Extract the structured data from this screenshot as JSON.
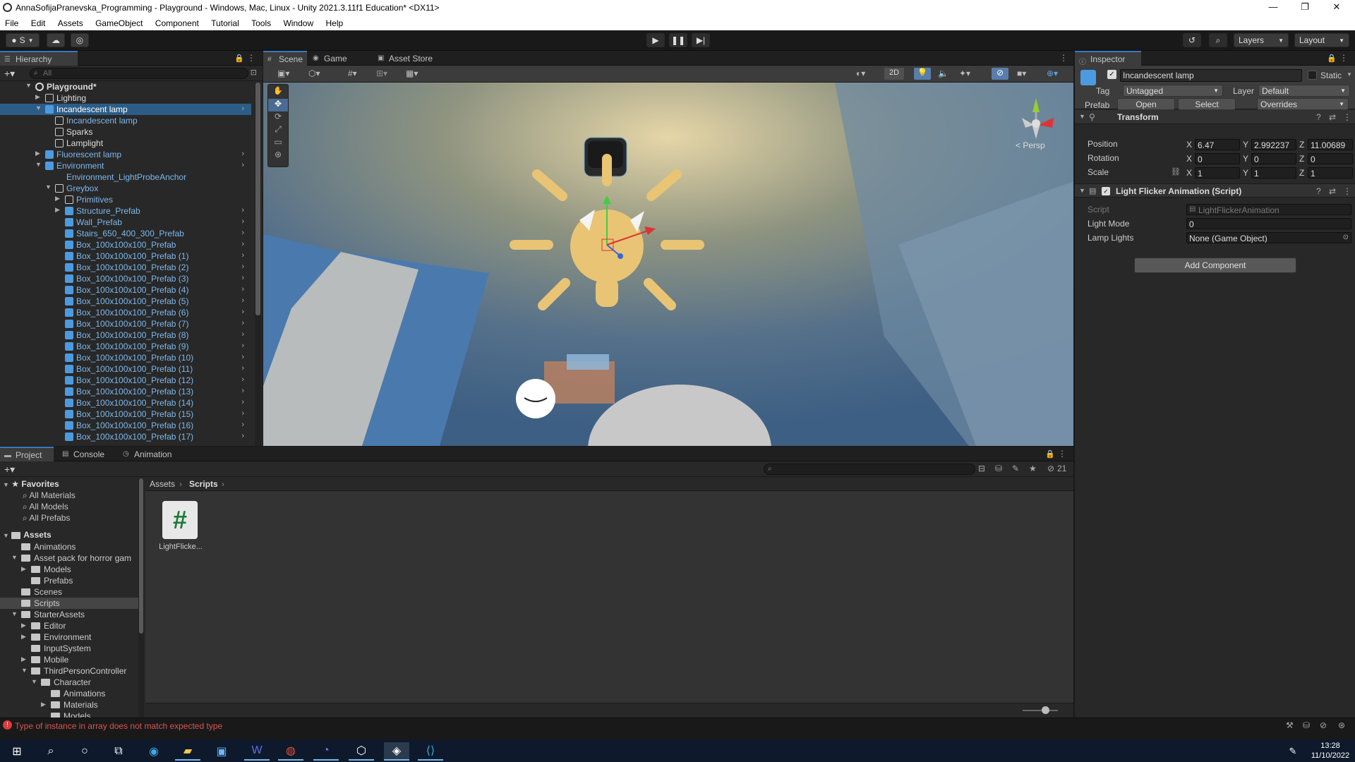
{
  "window": {
    "title": "AnnaSofijaPranevska_Programming - Playground - Windows, Mac, Linux - Unity 2021.3.11f1 Education* <DX11>",
    "minimize": "—",
    "maximize": "❐",
    "close": "✕"
  },
  "menu": [
    "File",
    "Edit",
    "Assets",
    "GameObject",
    "Component",
    "Tutorial",
    "Tools",
    "Window",
    "Help"
  ],
  "toolbar": {
    "account": "S",
    "layers": "Layers",
    "layout": "Layout",
    "play_icon": "play-icon",
    "pause_icon": "pause-icon",
    "step_icon": "step-icon"
  },
  "hierarchy": {
    "tab": "Hierarchy",
    "search_placeholder": "All",
    "rows": [
      {
        "label": "Playground*",
        "indent": 0,
        "expanded": true,
        "bold": true,
        "blue": false,
        "selected": false,
        "arrow": false,
        "icon": "scene"
      },
      {
        "label": "Lighting",
        "indent": 1,
        "expanded": false,
        "bold": false,
        "blue": false,
        "selected": false,
        "arrow": false,
        "icon": "cube-outline"
      },
      {
        "label": "Incandescent lamp",
        "indent": 1,
        "expanded": true,
        "bold": false,
        "blue": false,
        "selected": true,
        "arrow": true,
        "icon": "prefab"
      },
      {
        "label": "Incandescent lamp",
        "indent": 2,
        "expanded": null,
        "bold": false,
        "blue": true,
        "selected": false,
        "arrow": false,
        "icon": "cube-outline"
      },
      {
        "label": "Sparks",
        "indent": 2,
        "expanded": null,
        "bold": false,
        "blue": false,
        "selected": false,
        "arrow": false,
        "icon": "cube-outline"
      },
      {
        "label": "Lamplight",
        "indent": 2,
        "expanded": null,
        "bold": false,
        "blue": false,
        "selected": false,
        "arrow": false,
        "icon": "cube-outline"
      },
      {
        "label": "Fluorescent lamp",
        "indent": 1,
        "expanded": false,
        "bold": false,
        "blue": true,
        "selected": false,
        "arrow": true,
        "icon": "prefab"
      },
      {
        "label": "Environment",
        "indent": 1,
        "expanded": true,
        "bold": false,
        "blue": true,
        "selected": false,
        "arrow": true,
        "icon": "prefab"
      },
      {
        "label": "Environment_LightProbeAnchor",
        "indent": 2,
        "expanded": null,
        "bold": false,
        "blue": true,
        "selected": false,
        "arrow": false,
        "icon": "none"
      },
      {
        "label": "Greybox",
        "indent": 2,
        "expanded": true,
        "bold": false,
        "blue": true,
        "selected": false,
        "arrow": false,
        "icon": "cube-outline"
      },
      {
        "label": "Primitives",
        "indent": 3,
        "expanded": false,
        "bold": false,
        "blue": true,
        "selected": false,
        "arrow": false,
        "icon": "cube-outline"
      },
      {
        "label": "Structure_Prefab",
        "indent": 3,
        "expanded": false,
        "bold": false,
        "blue": true,
        "selected": false,
        "arrow": true,
        "icon": "prefab"
      },
      {
        "label": "Wall_Prefab",
        "indent": 3,
        "expanded": null,
        "bold": false,
        "blue": true,
        "selected": false,
        "arrow": true,
        "icon": "prefab"
      },
      {
        "label": "Stairs_650_400_300_Prefab",
        "indent": 3,
        "expanded": null,
        "bold": false,
        "blue": true,
        "selected": false,
        "arrow": true,
        "icon": "prefab"
      },
      {
        "label": "Box_100x100x100_Prefab",
        "indent": 3,
        "expanded": null,
        "bold": false,
        "blue": true,
        "selected": false,
        "arrow": true,
        "icon": "prefab"
      },
      {
        "label": "Box_100x100x100_Prefab (1)",
        "indent": 3,
        "expanded": null,
        "bold": false,
        "blue": true,
        "selected": false,
        "arrow": true,
        "icon": "prefab"
      },
      {
        "label": "Box_100x100x100_Prefab (2)",
        "indent": 3,
        "expanded": null,
        "bold": false,
        "blue": true,
        "selected": false,
        "arrow": true,
        "icon": "prefab"
      },
      {
        "label": "Box_100x100x100_Prefab (3)",
        "indent": 3,
        "expanded": null,
        "bold": false,
        "blue": true,
        "selected": false,
        "arrow": true,
        "icon": "prefab"
      },
      {
        "label": "Box_100x100x100_Prefab (4)",
        "indent": 3,
        "expanded": null,
        "bold": false,
        "blue": true,
        "selected": false,
        "arrow": true,
        "icon": "prefab"
      },
      {
        "label": "Box_100x100x100_Prefab (5)",
        "indent": 3,
        "expanded": null,
        "bold": false,
        "blue": true,
        "selected": false,
        "arrow": true,
        "icon": "prefab"
      },
      {
        "label": "Box_100x100x100_Prefab (6)",
        "indent": 3,
        "expanded": null,
        "bold": false,
        "blue": true,
        "selected": false,
        "arrow": true,
        "icon": "prefab"
      },
      {
        "label": "Box_100x100x100_Prefab (7)",
        "indent": 3,
        "expanded": null,
        "bold": false,
        "blue": true,
        "selected": false,
        "arrow": true,
        "icon": "prefab"
      },
      {
        "label": "Box_100x100x100_Prefab (8)",
        "indent": 3,
        "expanded": null,
        "bold": false,
        "blue": true,
        "selected": false,
        "arrow": true,
        "icon": "prefab"
      },
      {
        "label": "Box_100x100x100_Prefab (9)",
        "indent": 3,
        "expanded": null,
        "bold": false,
        "blue": true,
        "selected": false,
        "arrow": true,
        "icon": "prefab"
      },
      {
        "label": "Box_100x100x100_Prefab (10)",
        "indent": 3,
        "expanded": null,
        "bold": false,
        "blue": true,
        "selected": false,
        "arrow": true,
        "icon": "prefab"
      },
      {
        "label": "Box_100x100x100_Prefab (11)",
        "indent": 3,
        "expanded": null,
        "bold": false,
        "blue": true,
        "selected": false,
        "arrow": true,
        "icon": "prefab"
      },
      {
        "label": "Box_100x100x100_Prefab (12)",
        "indent": 3,
        "expanded": null,
        "bold": false,
        "blue": true,
        "selected": false,
        "arrow": true,
        "icon": "prefab"
      },
      {
        "label": "Box_100x100x100_Prefab (13)",
        "indent": 3,
        "expanded": null,
        "bold": false,
        "blue": true,
        "selected": false,
        "arrow": true,
        "icon": "prefab"
      },
      {
        "label": "Box_100x100x100_Prefab (14)",
        "indent": 3,
        "expanded": null,
        "bold": false,
        "blue": true,
        "selected": false,
        "arrow": true,
        "icon": "prefab"
      },
      {
        "label": "Box_100x100x100_Prefab (15)",
        "indent": 3,
        "expanded": null,
        "bold": false,
        "blue": true,
        "selected": false,
        "arrow": true,
        "icon": "prefab"
      },
      {
        "label": "Box_100x100x100_Prefab (16)",
        "indent": 3,
        "expanded": null,
        "bold": false,
        "blue": true,
        "selected": false,
        "arrow": true,
        "icon": "prefab"
      },
      {
        "label": "Box_100x100x100_Prefab (17)",
        "indent": 3,
        "expanded": null,
        "bold": false,
        "blue": true,
        "selected": false,
        "arrow": true,
        "icon": "prefab"
      }
    ]
  },
  "scene": {
    "tabs": [
      "Scene",
      "Game",
      "Asset Store"
    ],
    "btn_2d": "2D",
    "persp": "< Persp"
  },
  "inspector": {
    "tab": "Inspector",
    "object_name": "Incandescent lamp",
    "static_label": "Static",
    "tag_label": "Tag",
    "tag_value": "Untagged",
    "layer_label": "Layer",
    "layer_value": "Default",
    "prefab_label": "Prefab",
    "open_btn": "Open",
    "select_btn": "Select",
    "overrides_btn": "Overrides",
    "transform": {
      "title": "Transform",
      "position_label": "Position",
      "rotation_label": "Rotation",
      "scale_label": "Scale",
      "axis_x": "X",
      "axis_y": "Y",
      "axis_z": "Z",
      "position": [
        "6.47",
        "2.992237",
        "11.00689"
      ],
      "rotation": [
        "0",
        "0",
        "0"
      ],
      "scale": [
        "1",
        "1",
        "1"
      ]
    },
    "script_comp": {
      "title": "Light Flicker Animation (Script)",
      "script_label": "Script",
      "script_value": "LightFlickerAnimation",
      "light_mode_label": "Light Mode",
      "light_mode_value": "0",
      "lamp_lights_label": "Lamp Lights",
      "lamp_lights_value": "None (Game Object)"
    },
    "add_component": "Add Component"
  },
  "project": {
    "tabs": [
      "Project",
      "Console",
      "Animation"
    ],
    "favorites_label": "Favorites",
    "favorites": [
      "All Materials",
      "All Models",
      "All Prefabs"
    ],
    "assets_label": "Assets",
    "tree": [
      {
        "label": "Animations",
        "indent": 1,
        "tri": ""
      },
      {
        "label": "Asset pack for horror gam",
        "indent": 1,
        "tri": "▼"
      },
      {
        "label": "Models",
        "indent": 2,
        "tri": "▶"
      },
      {
        "label": "Prefabs",
        "indent": 2,
        "tri": ""
      },
      {
        "label": "Scenes",
        "indent": 1,
        "tri": ""
      },
      {
        "label": "Scripts",
        "indent": 1,
        "tri": "",
        "selected": true
      },
      {
        "label": "StarterAssets",
        "indent": 1,
        "tri": "▼"
      },
      {
        "label": "Editor",
        "indent": 2,
        "tri": "▶"
      },
      {
        "label": "Environment",
        "indent": 2,
        "tri": "▶"
      },
      {
        "label": "InputSystem",
        "indent": 2,
        "tri": ""
      },
      {
        "label": "Mobile",
        "indent": 2,
        "tri": "▶"
      },
      {
        "label": "ThirdPersonController",
        "indent": 2,
        "tri": "▼"
      },
      {
        "label": "Character",
        "indent": 3,
        "tri": "▼"
      },
      {
        "label": "Animations",
        "indent": 4,
        "tri": ""
      },
      {
        "label": "Materials",
        "indent": 4,
        "tri": "▶"
      },
      {
        "label": "Models",
        "indent": 4,
        "tri": ""
      }
    ],
    "breadcrumb": [
      "Assets",
      "Scripts"
    ],
    "file_label": "LightFlicke...",
    "hidden_count": "21"
  },
  "status": {
    "error": "Type of instance in array does not match expected type"
  },
  "taskbar": {
    "time": "13:28",
    "date": "11/10/2022"
  }
}
